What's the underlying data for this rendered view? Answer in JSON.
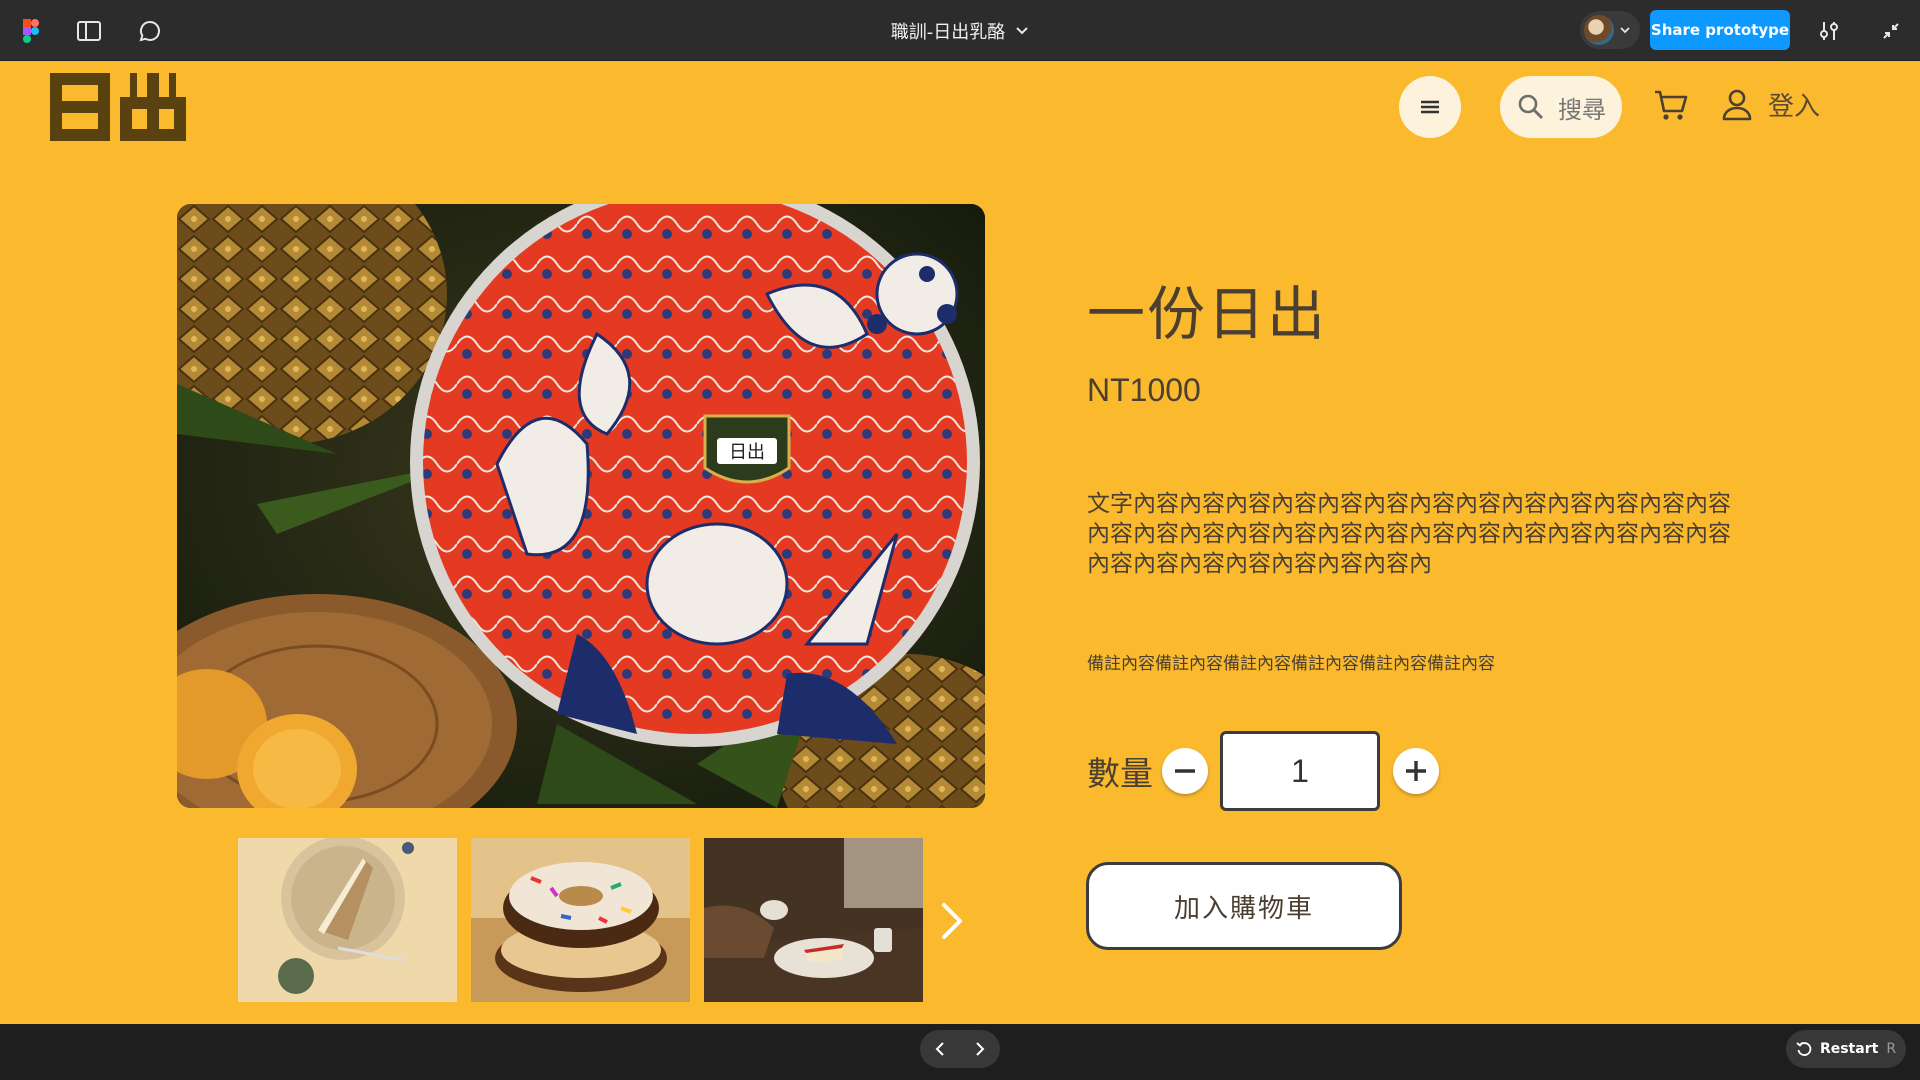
{
  "figma": {
    "file_title": "職訓-日出乳酪",
    "share_label": "Share prototype",
    "restart_label": "Restart",
    "restart_key": "R"
  },
  "site": {
    "logo_text": "日出",
    "search_placeholder": "搜尋",
    "login_label": "登入"
  },
  "product": {
    "title": "一份日出",
    "price": "NT1000",
    "description": "文字內容內容內容內容內容內容內容內容內容內容內容內容內容內容內容內容內容內容內容內容內容內容內容內容內容內容內容內容內容內容內容內容內容內容內",
    "note": "備註內容備註內容備註內容備註內容備註內容備註內容",
    "quantity_label": "數量",
    "quantity": "1",
    "add_to_cart_label": "加入購物車"
  },
  "colors": {
    "page_bg": "#fbba2e",
    "brand_dark": "#5a4210",
    "figma_blue": "#0d99ff"
  },
  "icons": [
    "figma-logo-icon",
    "sidebar-toggle-icon",
    "comment-icon",
    "chevron-down-icon",
    "settings-sliders-icon",
    "collapse-icon",
    "hamburger-menu-icon",
    "search-icon",
    "cart-icon",
    "user-icon",
    "minus-icon",
    "plus-icon",
    "chevron-right-icon",
    "chevron-left-icon",
    "restart-icon"
  ]
}
